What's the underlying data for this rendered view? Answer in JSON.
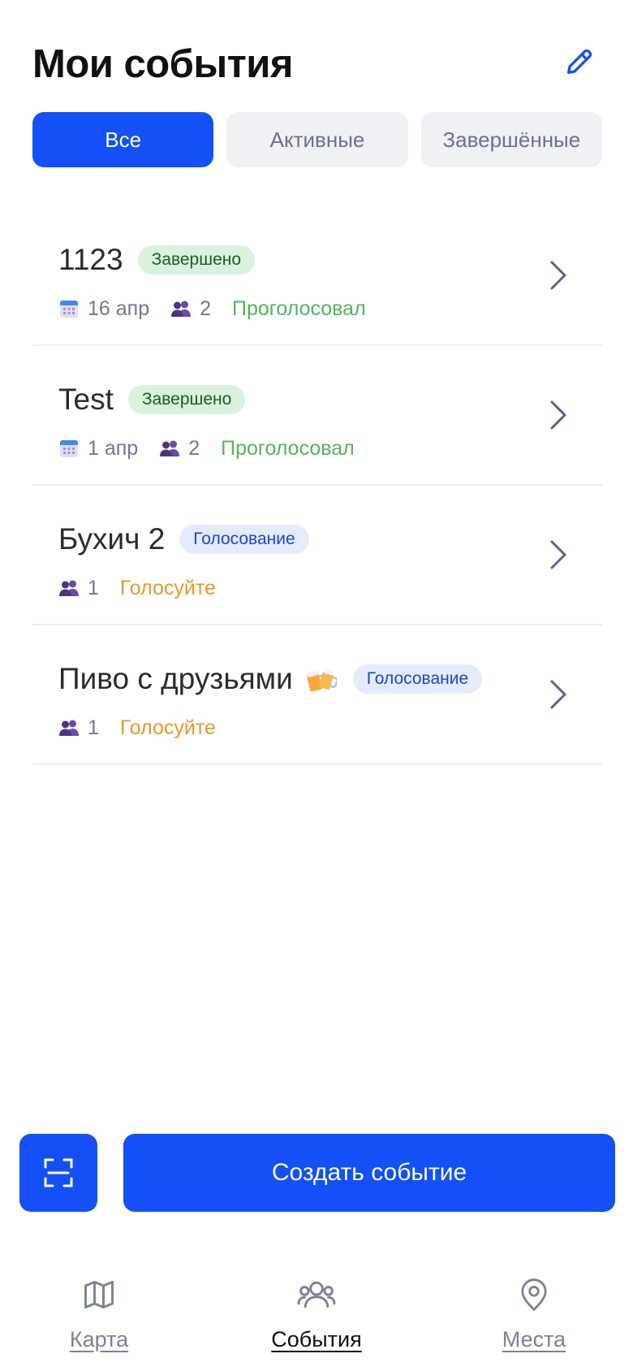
{
  "header": {
    "title": "Мои события"
  },
  "filters": [
    {
      "label": "Все",
      "active": true
    },
    {
      "label": "Активные",
      "active": false
    },
    {
      "label": "Завершённые",
      "active": false
    }
  ],
  "events": [
    {
      "name": "1123",
      "badge": "Завершено",
      "date": "16 апр",
      "participants": "2",
      "status": "Проголосовал"
    },
    {
      "name": "Test",
      "badge": "Завершено",
      "date": "1 апр",
      "participants": "2",
      "status": "Проголосовал"
    },
    {
      "name": "Бухич 2",
      "badge": "Голосование",
      "participants": "1",
      "status": "Голосуйте"
    },
    {
      "name": "Пиво с друзьями",
      "badge": "Голосование",
      "participants": "1",
      "status": "Голосуйте"
    }
  ],
  "actions": {
    "create_label": "Создать событие"
  },
  "tabbar": [
    {
      "label": "Карта",
      "icon": "map-icon"
    },
    {
      "label": "События",
      "icon": "users-icon",
      "active": true
    },
    {
      "label": "Места",
      "icon": "location-pin-icon"
    }
  ],
  "colors": {
    "accent": "#1450f5",
    "done_badge_bg": "#d9f1dd",
    "voting_badge_bg": "#e6ebfb",
    "voted": "#58b15e",
    "vote": "#f0952a"
  }
}
